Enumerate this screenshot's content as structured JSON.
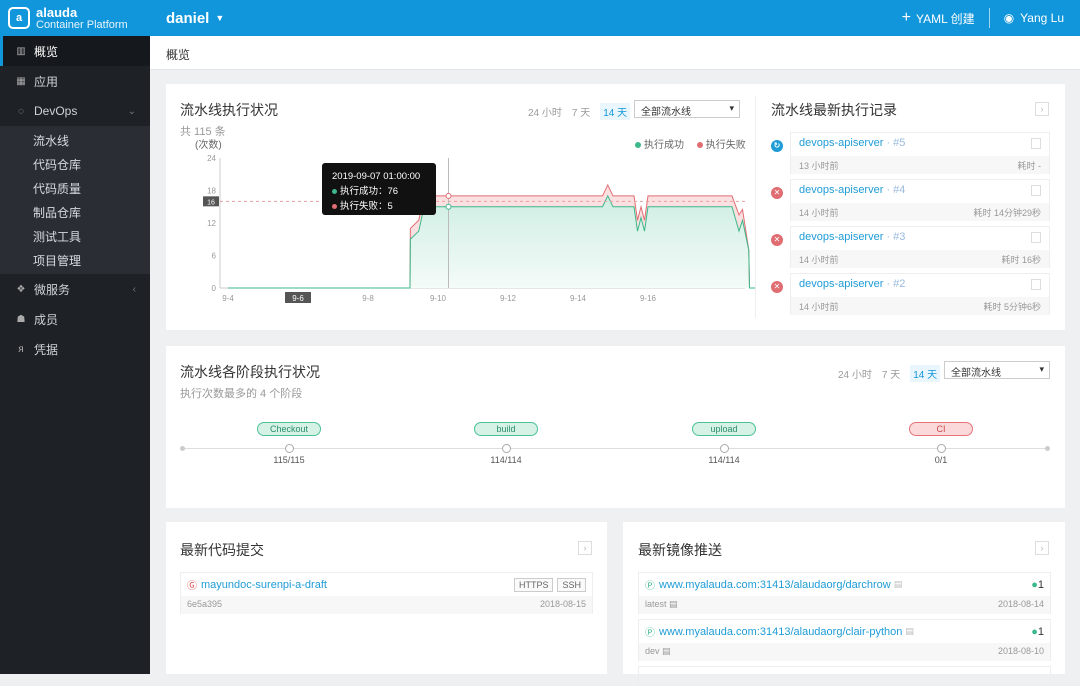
{
  "brand": {
    "name": "alauda",
    "product": "Container Platform"
  },
  "sidebar": {
    "items": [
      {
        "label": "概览",
        "icon": "bar-chart-icon"
      },
      {
        "label": "应用",
        "icon": "grid-icon"
      },
      {
        "label": "DevOps",
        "icon": "circle-icon"
      },
      {
        "label": "微服务",
        "icon": "cubes-icon"
      },
      {
        "label": "成员",
        "icon": "users-icon"
      },
      {
        "label": "凭据",
        "icon": "key-icon"
      }
    ],
    "devops_sub": [
      "流水线",
      "代码仓库",
      "代码质量",
      "制品仓库",
      "测试工具",
      "项目管理"
    ]
  },
  "header": {
    "project": "daniel",
    "create": "YAML 创建",
    "user": "Yang Lu"
  },
  "breadcrumb": "概览",
  "pipeline_status": {
    "title": "流水线执行状况",
    "subtitle": "共 115 条",
    "ranges": [
      "24 小时",
      "7 天",
      "14 天"
    ],
    "select": "全部流水线",
    "yunit": "(次数)",
    "legend": [
      "执行成功",
      "执行失败"
    ],
    "tooltip": {
      "time": "2019-09-07 01:00:00",
      "success_label": "执行成功：",
      "success": "76",
      "fail_label": "执行失败：",
      "fail": "5"
    },
    "crosshair_y": "16"
  },
  "chart_data": {
    "type": "area",
    "ylim": [
      0,
      24
    ],
    "yticks": [
      "0",
      "6",
      "12",
      "18",
      "24"
    ],
    "xticks": [
      "9-4",
      "9-6",
      "9-8",
      "9-10",
      "9-12",
      "9-14",
      "9-16"
    ],
    "highlight_x": "9-6",
    "colors": {
      "success": "#3db88b",
      "fail": "#e06d72"
    },
    "x_days": [
      0,
      5.2,
      5.21,
      5.45,
      5.6,
      6,
      8,
      10.7,
      10.85,
      11,
      11.6,
      11.7,
      11.8,
      11.9,
      12,
      14.4,
      14.6,
      14.7,
      14.88,
      14.9,
      16
    ],
    "series": [
      {
        "name": "执行成功",
        "values": [
          0,
          0,
          9,
          10.5,
          15,
          15,
          15,
          15,
          17,
          15,
          15,
          10.5,
          13,
          10.5,
          15,
          15,
          10.5,
          12.5,
          7,
          0,
          0
        ]
      },
      {
        "name": "执行失败",
        "values": [
          0,
          0,
          2,
          2,
          2,
          2,
          2,
          2,
          2,
          2,
          2,
          2,
          2,
          2,
          2,
          2,
          3,
          2,
          0,
          0,
          0
        ]
      }
    ]
  },
  "records": {
    "title": "流水线最新执行记录",
    "items": [
      {
        "name": "devops-apiserver",
        "num": "· #5",
        "ago": "13 小时前",
        "dur": "耗时 -",
        "status": "running"
      },
      {
        "name": "devops-apiserver",
        "num": "· #4",
        "ago": "14 小时前",
        "dur": "耗时 14分钟29秒",
        "status": "failed"
      },
      {
        "name": "devops-apiserver",
        "num": "· #3",
        "ago": "14 小时前",
        "dur": "耗时 16秒",
        "status": "failed"
      },
      {
        "name": "devops-apiserver",
        "num": "· #2",
        "ago": "14 小时前",
        "dur": "耗时 5分钟6秒",
        "status": "failed"
      }
    ]
  },
  "stages": {
    "title": "流水线各阶段执行状况",
    "subtitle": "执行次数最多的 4 个阶段",
    "ranges": [
      "24 小时",
      "7 天",
      "14 天"
    ],
    "select": "全部流水线",
    "items": [
      {
        "name": "Checkout",
        "count": "115/115",
        "ok": true
      },
      {
        "name": "build",
        "count": "114/114",
        "ok": true
      },
      {
        "name": "upload",
        "count": "114/114",
        "ok": true
      },
      {
        "name": "CI",
        "count": "0/1",
        "ok": false
      }
    ]
  },
  "commits": {
    "title": "最新代码提交",
    "items": [
      {
        "repo": "mayundoc-surenpi-a-draft",
        "hash": "6e5a395",
        "date": "2018-08-15",
        "tags": [
          "HTTPS",
          "SSH"
        ]
      }
    ]
  },
  "images": {
    "title": "最新镜像推送",
    "items": [
      {
        "repo": "www.myalauda.com:31413/alaudaorg/darchrow",
        "tag": "latest",
        "date": "2018-08-14",
        "count": "1"
      },
      {
        "repo": "www.myalauda.com:31413/alaudaorg/clair-python",
        "tag": "dev",
        "date": "2018-08-10",
        "count": "1"
      }
    ]
  }
}
